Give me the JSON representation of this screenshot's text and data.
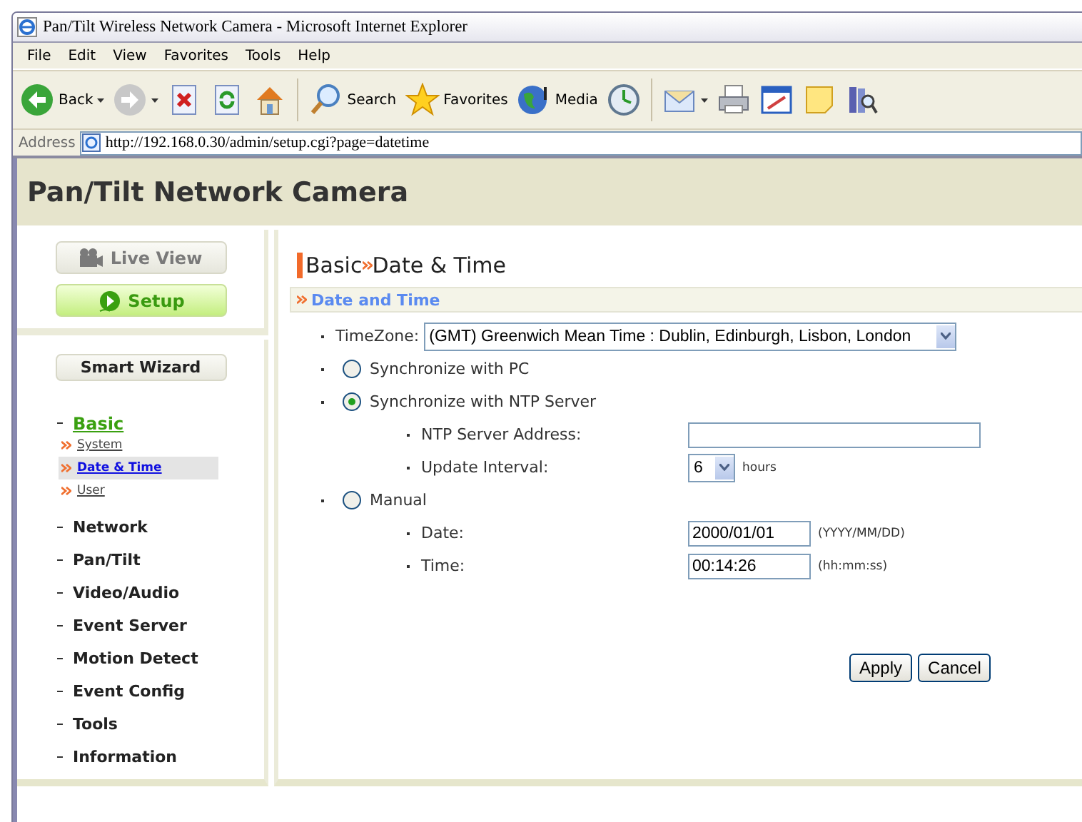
{
  "window": {
    "title": "Pan/Tilt Wireless Network Camera - Microsoft Internet Explorer"
  },
  "menu": [
    "File",
    "Edit",
    "View",
    "Favorites",
    "Tools",
    "Help"
  ],
  "toolbar": [
    {
      "kind": "back",
      "label": "Back",
      "dropdown": true
    },
    {
      "kind": "forward",
      "dropdown": true
    },
    {
      "kind": "stop",
      "dropdown": false
    },
    {
      "kind": "refresh",
      "dropdown": false
    },
    {
      "kind": "home",
      "dropdown": false
    },
    {
      "kind": "search",
      "label": "Search",
      "dropdown": false
    },
    {
      "kind": "favorites",
      "label": "Favorites",
      "dropdown": false
    },
    {
      "kind": "media",
      "label": "Media",
      "dropdown": false
    },
    {
      "kind": "history",
      "dropdown": false
    },
    {
      "kind": "mail",
      "dropdown": true
    },
    {
      "kind": "print",
      "dropdown": false
    },
    {
      "kind": "edit",
      "dropdown": false
    },
    {
      "kind": "note",
      "dropdown": false
    },
    {
      "kind": "research",
      "dropdown": false
    }
  ],
  "address": {
    "label": "Address",
    "url": "http://192.168.0.30/admin/setup.cgi?page=datetime"
  },
  "app_title": "Pan/Tilt Network Camera",
  "mode_buttons": [
    {
      "kind": "live",
      "label": "Live View",
      "selected": false
    },
    {
      "kind": "setup",
      "label": "Setup",
      "selected": true
    }
  ],
  "wizard_button": "Smart Wizard",
  "nav": [
    {
      "label": "Basic",
      "selected": true,
      "children": [
        {
          "label": "System",
          "selected": false
        },
        {
          "label": "Date & Time",
          "selected": true
        },
        {
          "label": "User",
          "selected": false
        }
      ]
    },
    {
      "label": "Network",
      "selected": false
    },
    {
      "label": "Pan/Tilt",
      "selected": false
    },
    {
      "label": "Video/Audio",
      "selected": false
    },
    {
      "label": "Event Server",
      "selected": false
    },
    {
      "label": "Motion Detect",
      "selected": false
    },
    {
      "label": "Event Config",
      "selected": false
    },
    {
      "label": "Tools",
      "selected": false
    },
    {
      "label": "Information",
      "selected": false
    }
  ],
  "page_title": {
    "section": "Basic",
    "page": "Date & Time"
  },
  "section_header": "Date and Time",
  "timezone": {
    "label": "TimeZone:",
    "value": "(GMT) Greenwich Mean Time : Dublin, Edinburgh, Lisbon, London"
  },
  "sync_options": [
    {
      "label": "Synchronize with PC",
      "selected": false
    },
    {
      "label": "Synchronize with NTP Server",
      "selected": true,
      "fields": [
        {
          "kind": "text",
          "label": "NTP Server Address:"
        },
        {
          "kind": "select",
          "label": "Update Interval:",
          "value": "6",
          "unit": "hours"
        }
      ]
    },
    {
      "label": "Manual",
      "selected": false,
      "fields": [
        {
          "kind": "text",
          "label": "Date:",
          "value": "2000/01/01",
          "unit": "(YYYY/MM/DD)"
        },
        {
          "kind": "text",
          "label": "Time:",
          "value": "00:14:26",
          "unit": "(hh:mm:ss)"
        }
      ]
    }
  ],
  "buttons": [
    "Apply",
    "Cancel"
  ]
}
